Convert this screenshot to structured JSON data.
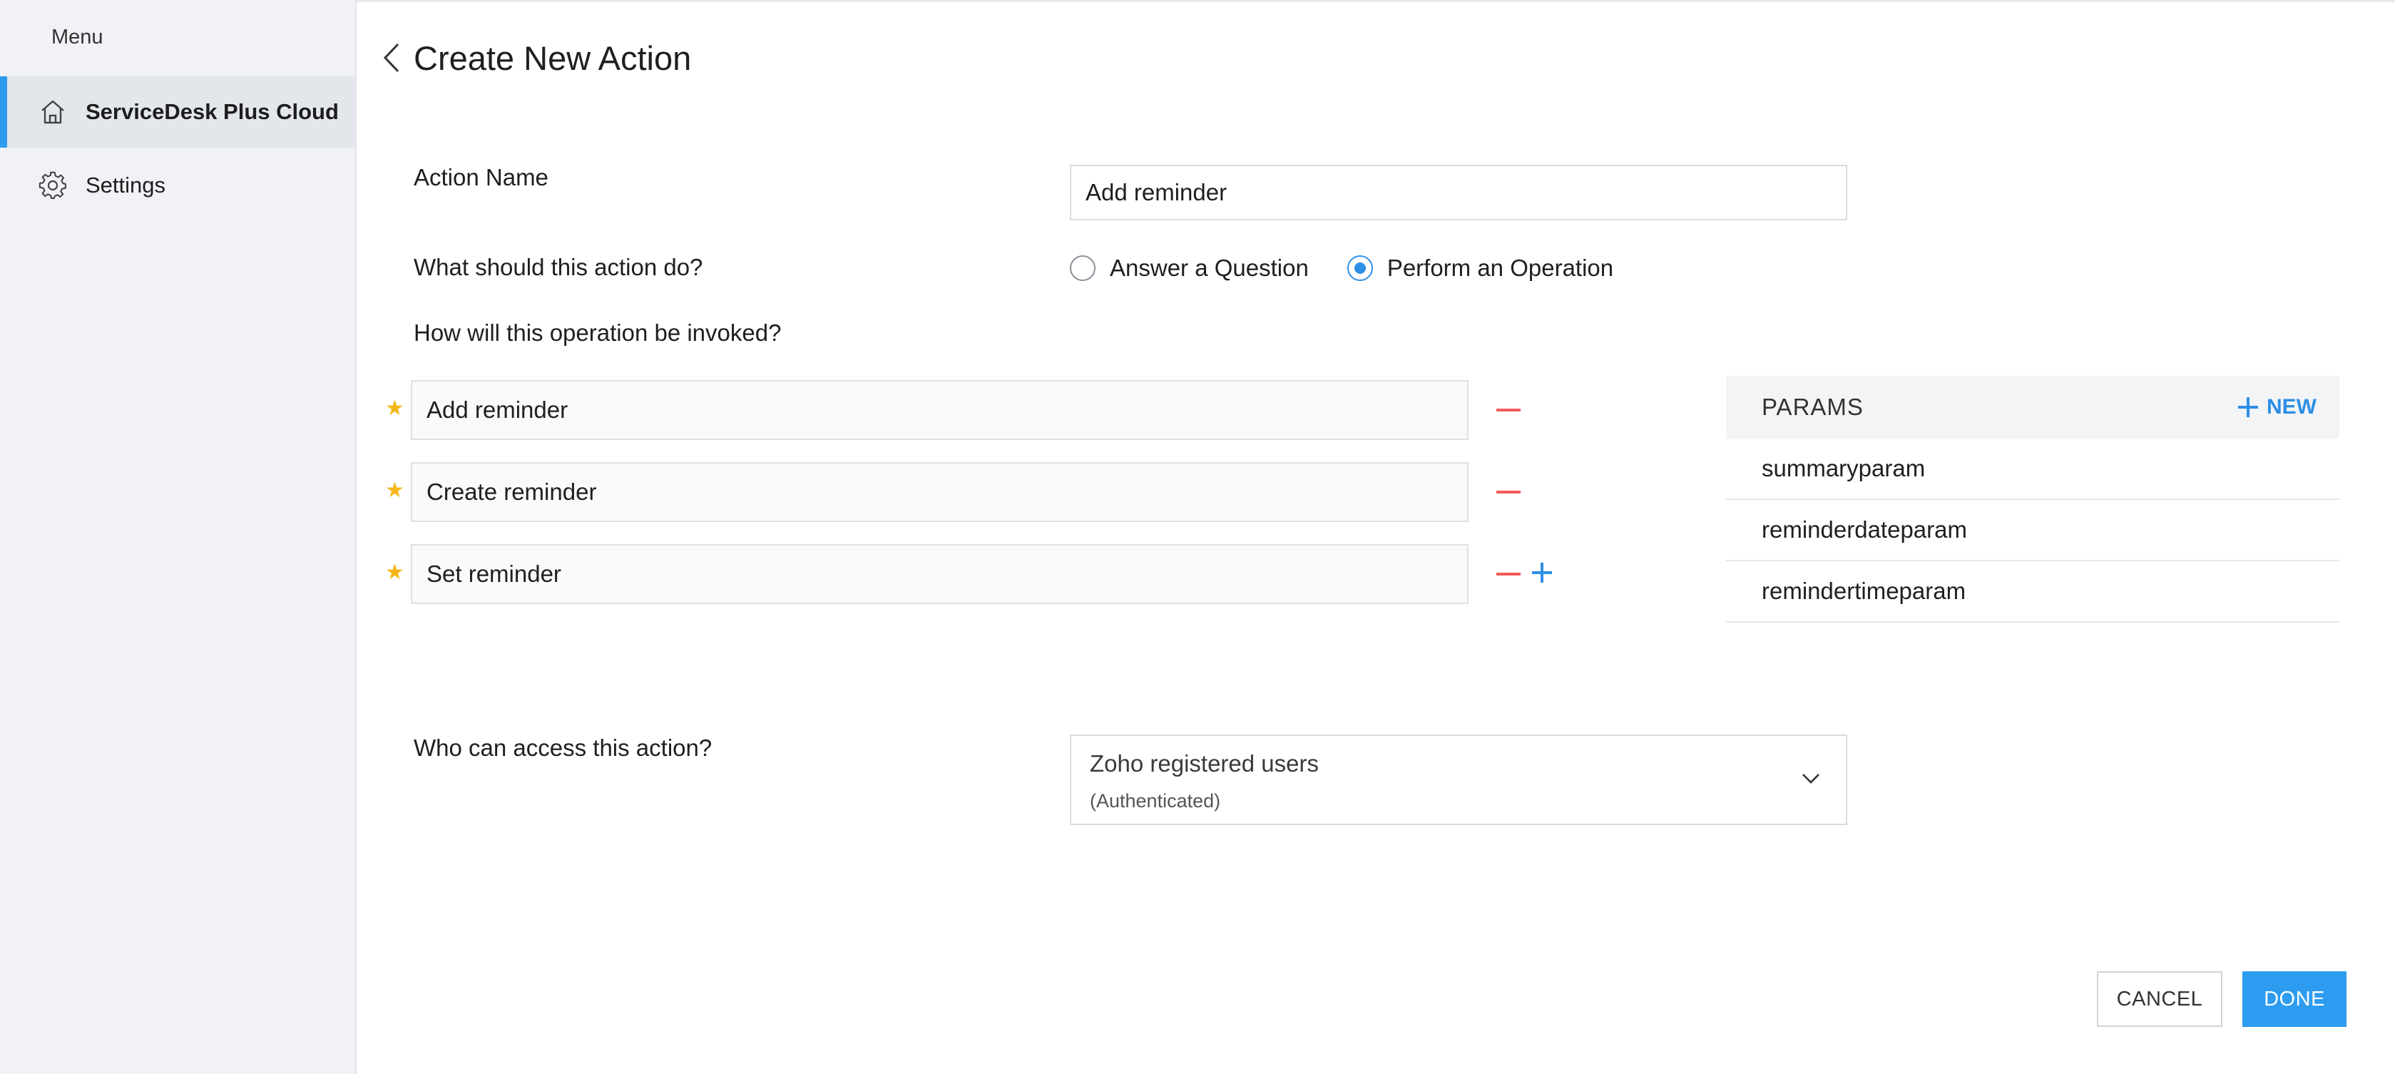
{
  "sidebar": {
    "menu_label": "Menu",
    "items": [
      {
        "label": "ServiceDesk Plus Cloud",
        "icon": "home-icon",
        "active": true
      },
      {
        "label": "Settings",
        "icon": "gear-icon",
        "active": false
      }
    ]
  },
  "header": {
    "title": "Create New Action",
    "back_icon": "chevron-left-icon"
  },
  "form": {
    "action_name_label": "Action Name",
    "action_name_value": "Add reminder",
    "action_type_label": "What should this action do?",
    "action_type_options": [
      {
        "label": "Answer a Question",
        "selected": false
      },
      {
        "label": "Perform an Operation",
        "selected": true
      }
    ],
    "invocation_label": "How will this operation be invoked?",
    "utterances": [
      "Add reminder",
      "Create reminder",
      "Set reminder"
    ],
    "access_label": "Who can access this action?",
    "access_value": "Zoho registered users",
    "access_subvalue": "(Authenticated)"
  },
  "params": {
    "title": "PARAMS",
    "new_label": "NEW",
    "items": [
      "summaryparam",
      "reminderdateparam",
      "remindertimeparam"
    ]
  },
  "buttons": {
    "cancel": "CANCEL",
    "done": "DONE"
  },
  "colors": {
    "accent": "#2d9cf0",
    "remove": "#f05a5a",
    "required_star": "#f5b819",
    "sidebar_bg": "#f0f2f6"
  }
}
